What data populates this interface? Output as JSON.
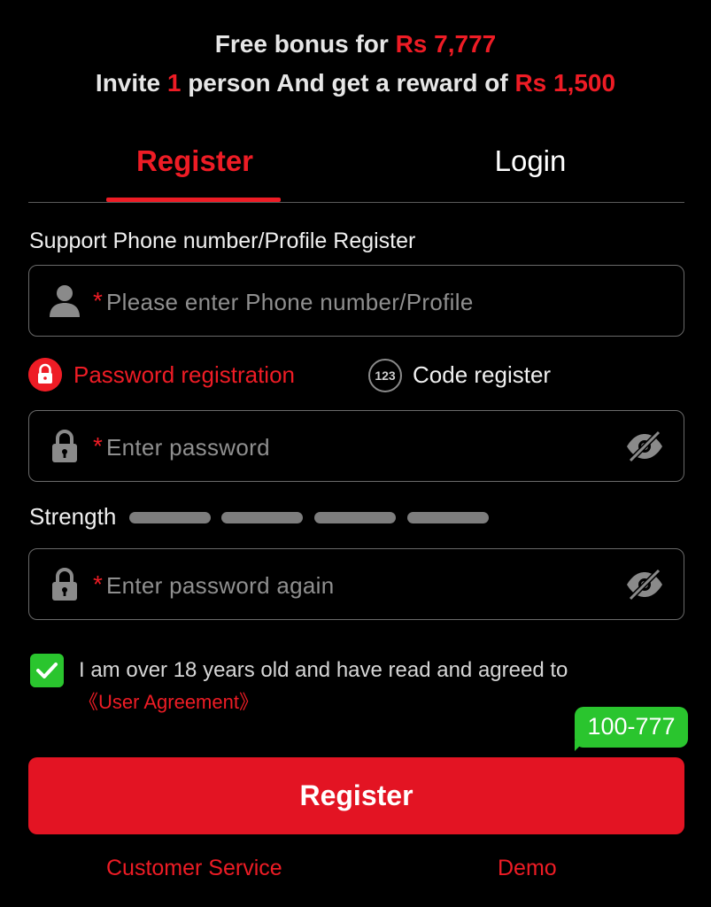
{
  "promo": {
    "line1_prefix": "Free bonus for ",
    "line1_amount": "Rs 7,777",
    "line2_a": "Invite ",
    "line2_count": "1",
    "line2_b": " person And get a reward of ",
    "line2_amount": "Rs 1,500"
  },
  "tabs": {
    "register": "Register",
    "login": "Login",
    "active": "register"
  },
  "form": {
    "section_label": "Support Phone number/Profile Register",
    "required_mark": "*",
    "phone_placeholder": "Please enter Phone number/Profile",
    "mode_password": "Password registration",
    "mode_code": "Code register",
    "mode_code_icon_text": "123",
    "active_mode": "password",
    "password_placeholder": "Enter password",
    "password_again_placeholder": "Enter password again",
    "strength_label": "Strength",
    "strength_level": 0,
    "strength_segments": 4,
    "agree_checked": true,
    "agree_text": "I am over 18 years old and have read and agreed to",
    "agree_link": "《User Agreement》",
    "submit": "Register"
  },
  "badge": {
    "text": "100-777"
  },
  "footer": {
    "customer_service": "Customer Service",
    "demo": "Demo"
  },
  "icons": {
    "phone_field": "user-icon",
    "password_field": "lock-icon",
    "visibility": "eye-off-icon",
    "mode_password": "lock-icon",
    "checkbox": "check-icon"
  },
  "colors": {
    "background": "#000000",
    "accent": "#ee1c25",
    "button": "#e31423",
    "success": "#2ac52e",
    "strength_inactive": "#7d7d7d"
  }
}
